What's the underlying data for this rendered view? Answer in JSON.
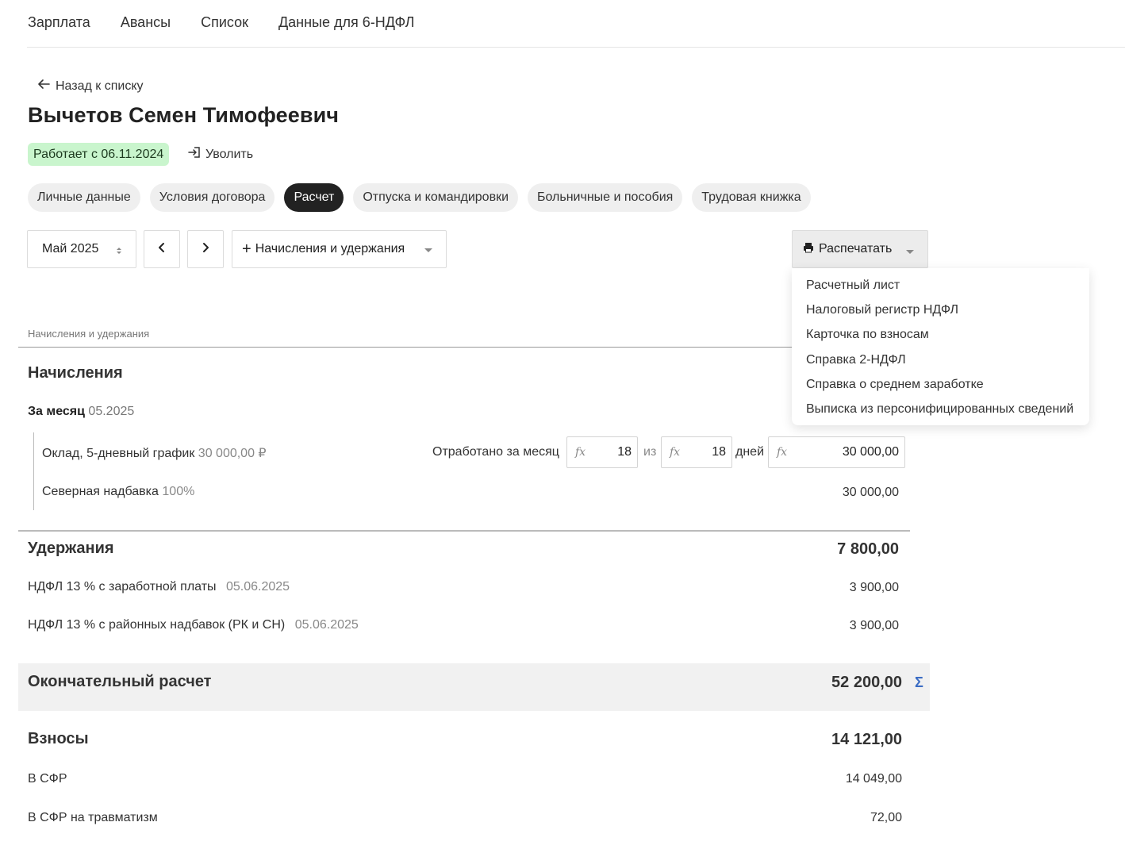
{
  "topnav": {
    "items": [
      "Зарплата",
      "Авансы",
      "Список",
      "Данные для 6-НДФЛ"
    ]
  },
  "back": {
    "label": "Назад к списку"
  },
  "employee": {
    "name": "Вычетов Семен Тимофеевич",
    "status": "Работает с 06.11.2024",
    "fire_label": "Уволить"
  },
  "tabs": {
    "items": [
      "Личные данные",
      "Условия договора",
      "Расчет",
      "Отпуска и командировки",
      "Больничные и пособия",
      "Трудовая книжка"
    ],
    "active": "Расчет"
  },
  "toolbar": {
    "month": "Май 2025",
    "accruals_plus": "+",
    "accruals_label": "Начисления и удержания",
    "print_label": "Распечатать"
  },
  "print_menu": {
    "items": [
      "Расчетный лист",
      "Налоговый регистр НДФЛ",
      "Карточка по взносам",
      "Справка 2-НДФЛ",
      "Справка о среднем заработке",
      "Выписка из персонифицированных сведений"
    ]
  },
  "caption": "Начисления и удержания",
  "accruals": {
    "title": "Начисления",
    "period_label": "За месяц",
    "period_value": "05.2025",
    "salary": {
      "name": "Оклад, 5-дневный график",
      "rate": "30 000,00 ₽",
      "worked_label": "Отработано за месяц",
      "worked_days": "18",
      "of_label": "из",
      "total_days": "18",
      "days_label": "дней",
      "fx": "fx",
      "amount": "30 000,00"
    },
    "northern": {
      "name": "Северная надбавка",
      "percent": "100%",
      "amount": "30 000,00"
    }
  },
  "deductions": {
    "title": "Удержания",
    "total": "7 800,00",
    "rows": [
      {
        "name": "НДФЛ 13 % с заработной платы",
        "date": "05.06.2025",
        "amount": "3 900,00"
      },
      {
        "name": "НДФЛ 13 % с районных надбавок (РК и СН)",
        "date": "05.06.2025",
        "amount": "3 900,00"
      }
    ]
  },
  "final": {
    "title": "Окончательный расчет",
    "total": "52 200,00",
    "sigma": "Σ"
  },
  "contributions": {
    "title": "Взносы",
    "total": "14 121,00",
    "rows": [
      {
        "name": "В СФР",
        "amount": "14 049,00"
      },
      {
        "name": "В СФР на травматизм",
        "amount": "72,00"
      }
    ]
  }
}
